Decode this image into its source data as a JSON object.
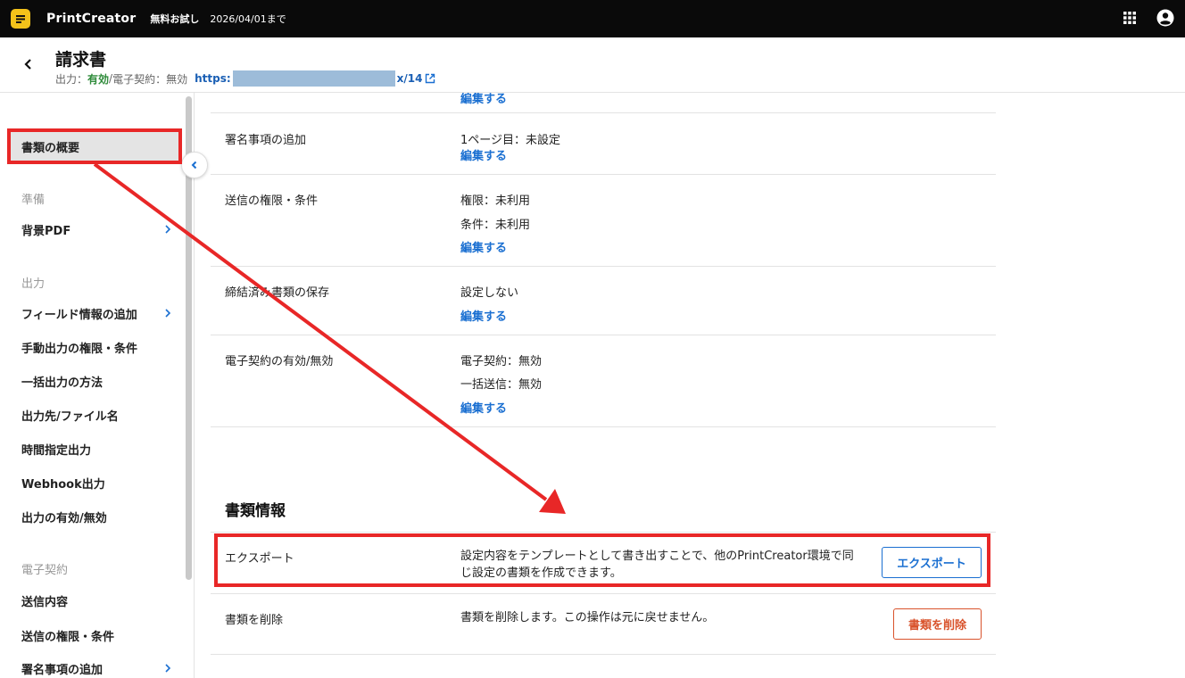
{
  "topbar": {
    "brand": "PrintCreator",
    "trial_label": "無料お試し",
    "trial_date": "2026/04/01まで"
  },
  "header": {
    "title": "請求書",
    "output_label": "出力：",
    "output_value": "有効",
    "separator": " / ",
    "contract_label": "電子契約：無効",
    "url_start": "https:",
    "url_end": "x/14"
  },
  "sidebar": {
    "overview": "書類の概要",
    "section_prep": "準備",
    "bg_pdf": "背景PDF",
    "section_output": "出力",
    "field_info": "フィールド情報の追加",
    "manual_output": "手動出力の権限・条件",
    "bulk_output": "一括出力の方法",
    "destination": "出力先/ファイル名",
    "scheduled": "時間指定出力",
    "webhook": "Webhook出力",
    "output_toggle": "出力の有効/無効",
    "section_contract": "電子契約",
    "send_content": "送信内容",
    "send_permission": "送信の権限・条件",
    "signature": "署名事項の追加"
  },
  "rows": {
    "edit_link": "編集する",
    "signature_label": "署名事項の追加",
    "signature_value": "1ページ目：未設定",
    "send_label": "送信の権限・条件",
    "send_permission": "権限：未利用",
    "send_condition": "条件：未利用",
    "save_label": "締結済み書類の保存",
    "save_value": "設定しない",
    "contract_label": "電子契約の有効/無効",
    "contract_value": "電子契約：無効",
    "bulk_send_value": "一括送信：無効"
  },
  "doc_info": {
    "title": "書類情報",
    "export_label": "エクスポート",
    "export_desc_1": "設定内容をテンプレートとして書き出すことで、他のPrintCreator環境で同",
    "export_desc_2": "じ設定の書類を作成できます。",
    "export_button": "エクスポート",
    "delete_label": "書類を削除",
    "delete_desc": "書類を削除します。この操作は元に戻せません。",
    "delete_button": "書類を削除"
  },
  "colors": {
    "accent": "#1a6fd1",
    "danger": "#d9532c",
    "annotation": "#e82727",
    "enabled": "#2e8b3a"
  }
}
